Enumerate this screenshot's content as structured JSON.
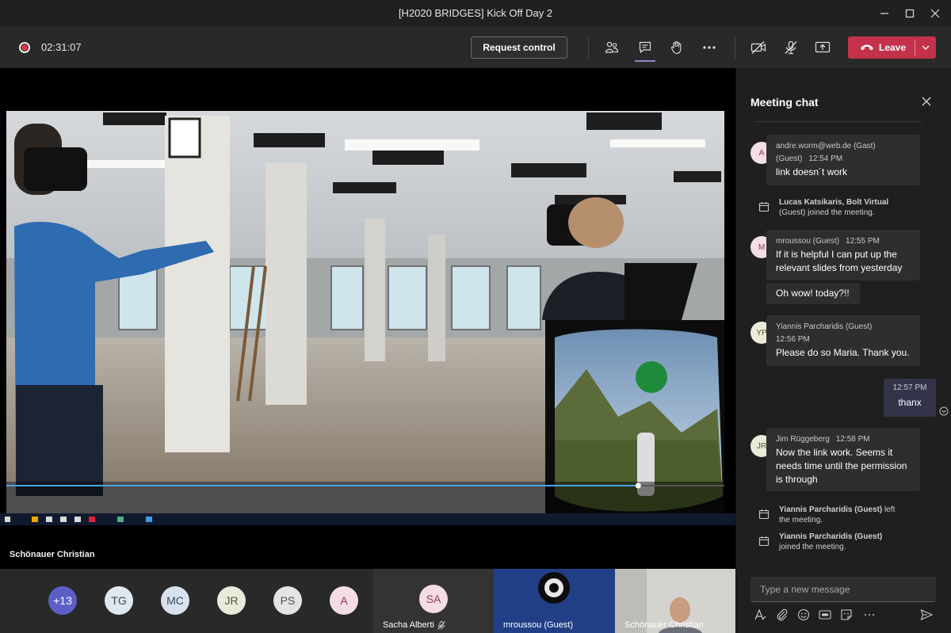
{
  "window": {
    "title": "[H2020 BRIDGES] Kick Off Day 2"
  },
  "toolbar": {
    "timer": "02:31:07",
    "request_control_label": "Request control",
    "leave_label": "Leave",
    "leave_color": "#c4314b",
    "icons": [
      "participants-icon",
      "chat-icon",
      "raise-hand-icon",
      "more-icon",
      "camera-off-icon",
      "mic-off-icon",
      "share-screen-icon"
    ]
  },
  "stage": {
    "presenter_name": "Schönauer Christian",
    "shared_video_progress_percent": 88
  },
  "participants_strip": {
    "avatars": [
      {
        "initials": "+13",
        "bg": "#5b5fc7",
        "fg": "#ffffff"
      },
      {
        "initials": "TG",
        "bg": "#dfe8ef",
        "fg": "#3b4a57"
      },
      {
        "initials": "MC",
        "bg": "#d9e0ee",
        "fg": "#3b4a64"
      },
      {
        "initials": "JR",
        "bg": "#e9ebd9",
        "fg": "#545a31"
      },
      {
        "initials": "PS",
        "bg": "#e3e4e6",
        "fg": "#4b4f55"
      },
      {
        "initials": "A",
        "bg": "#f4dde4",
        "fg": "#8c3b55"
      }
    ],
    "tiles": [
      {
        "name": "Sacha Alberti",
        "initials": "SA"
      },
      {
        "name": "mroussou (Guest)"
      },
      {
        "name": "Schönauer Christian"
      }
    ]
  },
  "chat": {
    "title": "Meeting chat",
    "messages": [
      {
        "initials": "A",
        "sender": "andre.worm@web.de (Gast)",
        "sender_line2": "(Guest)",
        "time": "12:54 PM",
        "text": "link doesn´t work",
        "avatar_bg": "#f4dde4",
        "avatar_fg": "#8c3b55",
        "status": "away"
      },
      {
        "system": true,
        "who": "Lucas Katsikaris, Bolt Virtual",
        "text": "(Guest) joined the meeting."
      },
      {
        "initials": "M",
        "sender": "mroussou (Guest)",
        "time": "12:55 PM",
        "text_lines": [
          "If it is helpful I can put up the",
          "relevant slides from yesterday"
        ],
        "avatar_bg": "#f4dde4",
        "avatar_fg": "#8c3b55",
        "status": "busy"
      },
      {
        "text": "Oh wow! today?!!"
      },
      {
        "initials": "YP",
        "sender": "Yiannis Parcharidis (Guest)",
        "time": "12:56 PM",
        "text": "Please do so Maria. Thank you.",
        "avatar_bg": "#ecebd9",
        "avatar_fg": "#545a31",
        "status": "away"
      },
      {
        "mine": true,
        "time": "12:57 PM",
        "text": "thanx"
      },
      {
        "initials": "JR",
        "sender": "Jim Rüggeberg",
        "time": "12:58 PM",
        "text_lines": [
          "Now the link work. Seems it",
          "needs time until the permission",
          "is through"
        ],
        "avatar_bg": "#e9ebd9",
        "avatar_fg": "#545a31",
        "status": "away"
      },
      {
        "system": true,
        "who": "Yiannis Parcharidis (Guest)",
        "who_suffix": " left",
        "text": "the meeting."
      },
      {
        "system": true,
        "who": "Yiannis Parcharidis (Guest)",
        "text": "joined the meeting."
      }
    ],
    "compose_placeholder": "Type a new message"
  }
}
